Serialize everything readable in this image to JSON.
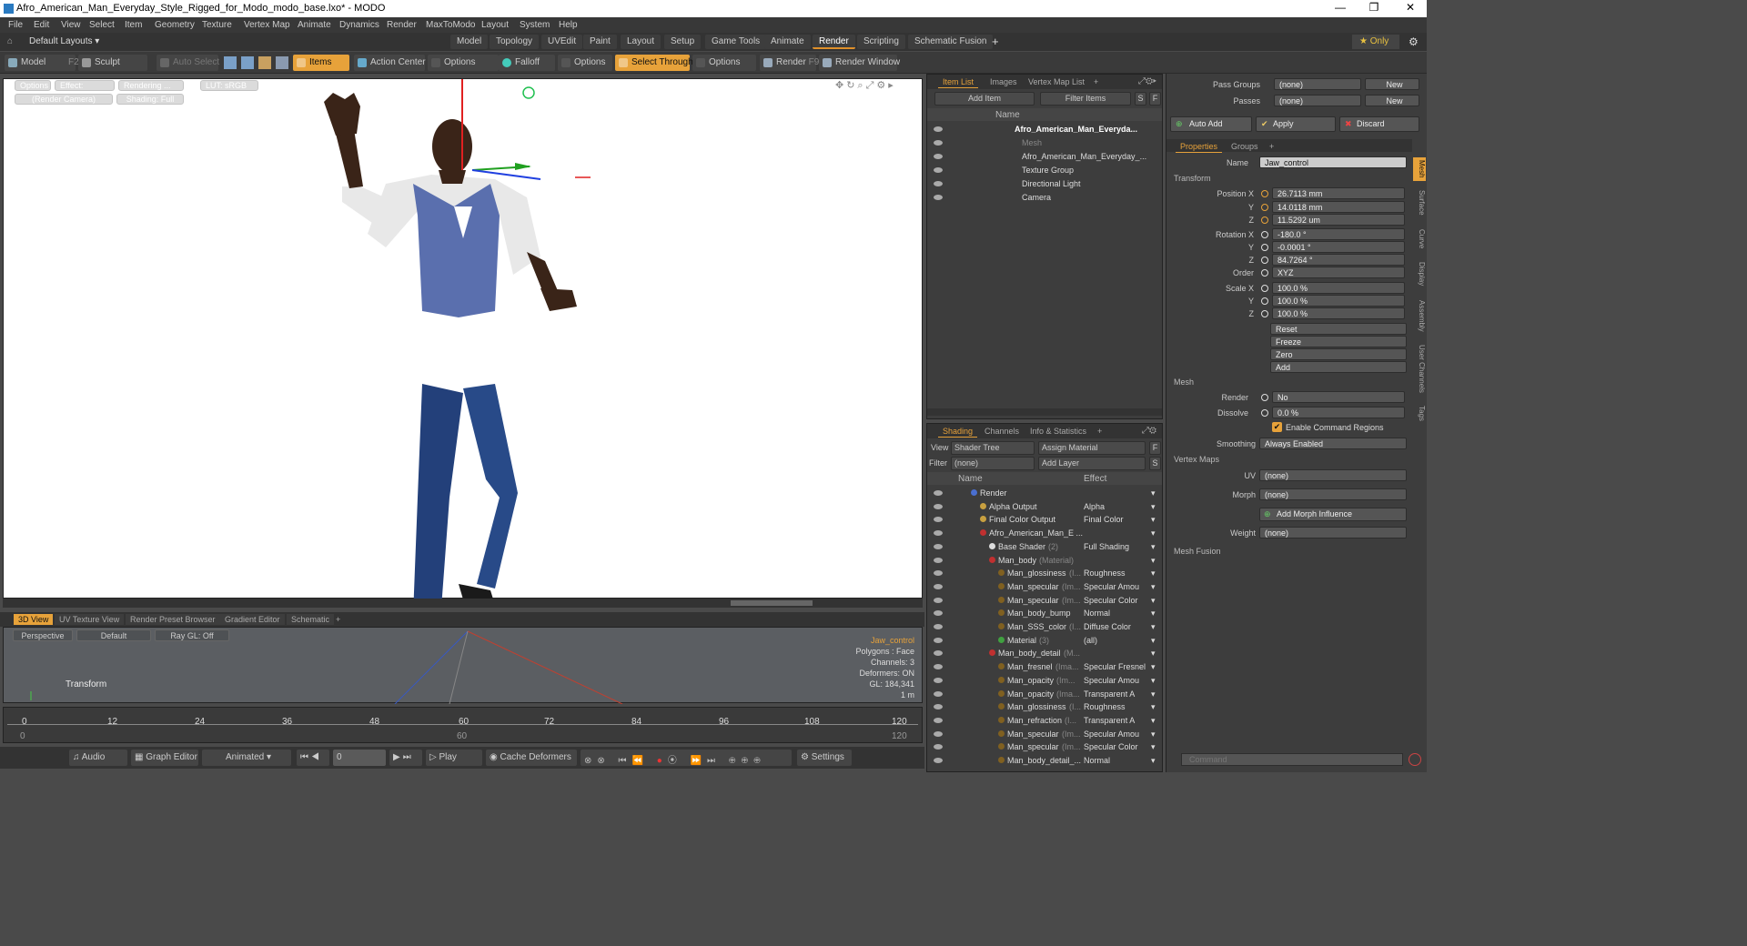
{
  "window": {
    "title": "Afro_American_Man_Everyday_Style_Rigged_for_Modo_modo_base.lxo* - MODO",
    "min": "—",
    "max": "❐",
    "close": "✕"
  },
  "menu": [
    "File",
    "Edit",
    "View",
    "Select",
    "Item",
    "Geometry",
    "Texture",
    "Vertex Map",
    "Animate",
    "Dynamics",
    "Render",
    "MaxToModo",
    "Layout",
    "System",
    "Help"
  ],
  "layout_bar": {
    "layouts_label": "Default Layouts ▾",
    "tabs": [
      "Model",
      "Topology",
      "UVEdit",
      "Paint",
      "Layout",
      "Setup",
      "Game Tools",
      "Animate",
      "Render",
      "Scripting",
      "Schematic Fusion"
    ],
    "active_tab": "Render",
    "add": "+",
    "only": "★ Only"
  },
  "toolbar": {
    "model": "Model",
    "model_key": "F2",
    "sculpt": "Sculpt",
    "auto_select": "Auto Select",
    "items": "Items",
    "action_center": "Action Center",
    "options1": "Options",
    "falloff": "Falloff",
    "options2": "Options",
    "select_through": "Select Through",
    "options3": "Options",
    "render": "Render",
    "render_key": "F9",
    "render_window": "Render Window"
  },
  "viewport": {
    "buttons": [
      "Options",
      "Effect: (Shadi...",
      "Rendering ...",
      "LUT: sRGB"
    ],
    "buttons2": [
      "(Render Camera)",
      "Shading: Full"
    ]
  },
  "bottom_tabs": [
    "3D View",
    "UV Texture View",
    "Render Preset Browser",
    "Gradient Editor",
    "Schematic",
    "+"
  ],
  "view3d": {
    "perspective": "Perspective",
    "default": "Default",
    "raygl": "Ray GL: Off",
    "transform": "Transform",
    "info": [
      "Jaw_control",
      "Polygons : Face",
      "Channels: 3",
      "Deformers: ON",
      "GL: 184,341",
      "1 m"
    ]
  },
  "timeline": {
    "ticks": [
      "0",
      "12",
      "24",
      "36",
      "48",
      "60",
      "72",
      "84",
      "96",
      "108",
      "120"
    ],
    "sub": [
      "0",
      "60",
      "120"
    ]
  },
  "transport": {
    "audio": "Audio",
    "graph_editor": "Graph Editor",
    "animated": "Animated",
    "frame": "0",
    "play": "Play",
    "cache": "Cache Deformers",
    "settings": "Settings"
  },
  "item_panel": {
    "tabs": [
      "Item List",
      "Images",
      "Vertex Map List",
      "+"
    ],
    "add_item": "Add Item",
    "filter": "Filter Items",
    "s": "S",
    "f": "F",
    "col_name": "Name",
    "rows": [
      {
        "label": "Afro_American_Man_Everyda...",
        "indent": 0,
        "bold": true
      },
      {
        "label": "Mesh",
        "indent": 1,
        "dim": true
      },
      {
        "label": "Afro_American_Man_Everyday_...",
        "indent": 1
      },
      {
        "label": "Texture Group",
        "indent": 1
      },
      {
        "label": "Directional Light",
        "indent": 1
      },
      {
        "label": "Camera",
        "indent": 1
      }
    ]
  },
  "shade_panel": {
    "tabs": [
      "Shading",
      "Channels",
      "Info & Statistics",
      "+"
    ],
    "view_label": "View",
    "view_value": "Shader Tree",
    "assign": "Assign Material",
    "f": "F",
    "filter_label": "Filter",
    "filter_value": "(none)",
    "add_layer": "Add Layer",
    "s": "S",
    "col_name": "Name",
    "col_effect": "Effect",
    "rows": [
      {
        "name": "Render",
        "sub": "",
        "effect": "",
        "indent": 0,
        "color": "#4a6fd0"
      },
      {
        "name": "Alpha Output",
        "sub": "",
        "effect": "Alpha",
        "indent": 1,
        "color": "#c8a040"
      },
      {
        "name": "Final Color Output",
        "sub": "",
        "effect": "Final Color",
        "indent": 1,
        "color": "#c8a040"
      },
      {
        "name": "Afro_American_Man_E ...",
        "sub": "",
        "effect": "",
        "indent": 1,
        "color": "#c03030"
      },
      {
        "name": "Base Shader",
        "sub": "(2)",
        "effect": "Full Shading",
        "indent": 2,
        "color": "#dddddd"
      },
      {
        "name": "Man_body",
        "sub": "(Material)",
        "effect": "",
        "indent": 2,
        "color": "#c03030"
      },
      {
        "name": "Man_glossiness",
        "sub": "(I...",
        "effect": "Roughness",
        "indent": 3,
        "color": "#806020"
      },
      {
        "name": "Man_specular",
        "sub": "(Im...",
        "effect": "Specular Amou",
        "indent": 3,
        "color": "#806020"
      },
      {
        "name": "Man_specular",
        "sub": "(Im...",
        "effect": "Specular Color",
        "indent": 3,
        "color": "#806020"
      },
      {
        "name": "Man_body_bump",
        "sub": "",
        "effect": "Normal",
        "indent": 3,
        "color": "#806020"
      },
      {
        "name": "Man_SSS_color",
        "sub": "(I...",
        "effect": "Diffuse Color",
        "indent": 3,
        "color": "#806020"
      },
      {
        "name": "Material",
        "sub": "(3)",
        "effect": "(all)",
        "indent": 3,
        "color": "#40a040"
      },
      {
        "name": "Man_body_detail",
        "sub": "(M...",
        "effect": "",
        "indent": 2,
        "color": "#c03030"
      },
      {
        "name": "Man_fresnel",
        "sub": "(Ima...",
        "effect": "Specular Fresnel",
        "indent": 3,
        "color": "#806020"
      },
      {
        "name": "Man_opacity",
        "sub": "(Im...",
        "effect": "Specular Amou",
        "indent": 3,
        "color": "#806020"
      },
      {
        "name": "Man_opacity",
        "sub": "(Ima...",
        "effect": "Transparent A",
        "indent": 3,
        "color": "#806020"
      },
      {
        "name": "Man_glossiness",
        "sub": "(I...",
        "effect": "Roughness",
        "indent": 3,
        "color": "#806020"
      },
      {
        "name": "Man_refraction",
        "sub": "(I...",
        "effect": "Transparent A",
        "indent": 3,
        "color": "#806020"
      },
      {
        "name": "Man_specular",
        "sub": "(Im...",
        "effect": "Specular Amou",
        "indent": 3,
        "color": "#806020"
      },
      {
        "name": "Man_specular",
        "sub": "(Im...",
        "effect": "Specular Color",
        "indent": 3,
        "color": "#806020"
      },
      {
        "name": "Man_body_detail_...",
        "sub": "",
        "effect": "Normal",
        "indent": 3,
        "color": "#806020"
      }
    ]
  },
  "props": {
    "pass_groups_label": "Pass Groups",
    "pass_groups_value": "(none)",
    "new1": "New",
    "passes_label": "Passes",
    "passes_value": "(none)",
    "new2": "New",
    "auto_add": "Auto Add",
    "apply": "Apply",
    "discard": "Discard",
    "tabs": [
      "Properties",
      "Groups",
      "+"
    ],
    "name_label": "Name",
    "name_value": "Jaw_control",
    "transform": "Transform",
    "pos_label": "Position X",
    "pos_x": "26.7113 mm",
    "pos_y": "14.0118 mm",
    "pos_z": "11.5292 um",
    "rot_label": "Rotation X",
    "rot_x": "-180.0 °",
    "rot_y": "-0.0001 °",
    "rot_z": "84.7264 °",
    "order_label": "Order",
    "order_value": "XYZ",
    "scale_label": "Scale X",
    "scale_x": "100.0 %",
    "scale_y": "100.0 %",
    "scale_z": "100.0 %",
    "y": "Y",
    "z": "Z",
    "reset": "Reset",
    "freeze": "Freeze",
    "zero": "Zero",
    "add": "Add",
    "mesh": "Mesh",
    "render_label": "Render",
    "render_value": "No",
    "dissolve_label": "Dissolve",
    "dissolve_value": "0.0 %",
    "cmd_regions": "Enable Command Regions",
    "smoothing_label": "Smoothing",
    "smoothing_value": "Always Enabled",
    "vertex_maps": "Vertex Maps",
    "uv_label": "UV",
    "uv_value": "(none)",
    "morph_label": "Morph",
    "morph_value": "(none)",
    "add_morph": "Add Morph Influence",
    "weight_label": "Weight",
    "weight_value": "(none)",
    "mesh_fusion": "Mesh Fusion",
    "command_placeholder": "Command",
    "vtabs": [
      "Mesh",
      "Surface",
      "Curve",
      "Display",
      "Assembly",
      "User Channels",
      "Tags"
    ]
  }
}
